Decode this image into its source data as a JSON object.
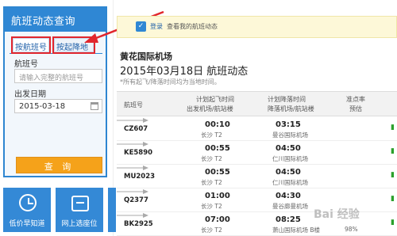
{
  "panel": {
    "title": "航班动态查询",
    "tab_flight_no": "按航班号",
    "tab_route": "按起降地",
    "flight_no_label": "航班号",
    "flight_no_placeholder": "请输入完整的航班号",
    "date_label": "出发日期",
    "date_value": "2015-03-18",
    "query_button": "查 询"
  },
  "tiles": [
    {
      "label": "低价早知道",
      "icon": "alarm-clock-icon"
    },
    {
      "label": "网上选座位",
      "icon": "seat-icon"
    }
  ],
  "notice": {
    "login_link": "登录",
    "text": "查看我的航班动态"
  },
  "results": {
    "airport": "黄花国际机场",
    "date_title": "2015年03月18日 航班动态",
    "note": "*所有起飞/降落时间均为当地时间。",
    "headers": {
      "flight_no": "航班号",
      "dep_line1": "计划起飞时间",
      "dep_line2": "出发机场/航站楼",
      "arr_line1": "计划降落时间",
      "arr_line2": "降落机场/航站楼",
      "ontime_line1": "准点率",
      "ontime_line2": "预估"
    },
    "rows": [
      {
        "flight_no": "CZ607",
        "dep_time": "00:10",
        "dep_place": "长沙 T2",
        "arr_time": "03:15",
        "arr_place": "曼谷国际机场",
        "ontime": ""
      },
      {
        "flight_no": "KE5890",
        "dep_time": "00:55",
        "dep_place": "长沙 T2",
        "arr_time": "04:50",
        "arr_place": "仁川国际机场",
        "ontime": ""
      },
      {
        "flight_no": "MU2023",
        "dep_time": "00:55",
        "dep_place": "长沙 T2",
        "arr_time": "04:50",
        "arr_place": "仁川国际机场",
        "ontime": ""
      },
      {
        "flight_no": "Q2377",
        "dep_time": "01:00",
        "dep_place": "长沙 T2",
        "arr_time": "04:30",
        "arr_place": "曼谷廊曼机场",
        "ontime": ""
      },
      {
        "flight_no": "BK2925",
        "dep_time": "07:00",
        "dep_place": "长沙 T2",
        "arr_time": "08:25",
        "arr_place": "萧山国际机场 B楼",
        "ontime": "98%"
      }
    ]
  },
  "watermark": "Bai 经验",
  "colors": {
    "primary_blue": "#2f87d4",
    "button_orange": "#f5a21a",
    "highlight_red": "#e1262d",
    "notice_bg": "#fdf8d8"
  }
}
